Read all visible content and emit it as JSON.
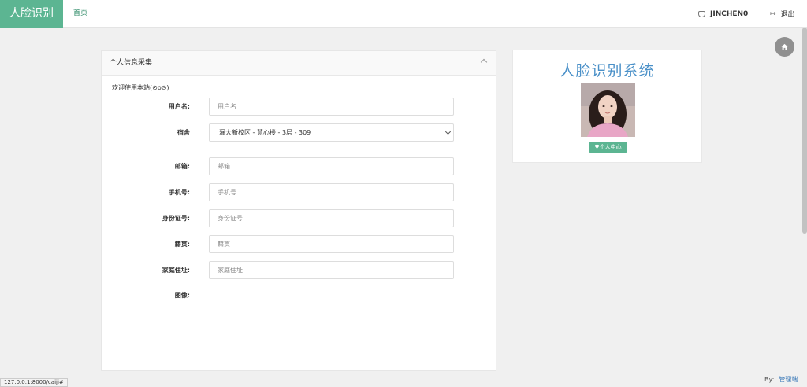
{
  "header": {
    "brand": "人脸识别",
    "nav_home": "首页",
    "username": "JINCHEN0",
    "logout": "退出"
  },
  "panel": {
    "title": "个人信息采集",
    "welcome": "欢迎使用本站(⊙o⊙)",
    "fields": {
      "username": {
        "label": "用户名:",
        "placeholder": "用户名"
      },
      "dorm": {
        "label": "宿舍",
        "value": "漏大新校区 - 慧心楼 - 3层 - 309"
      },
      "email": {
        "label": "邮箱:",
        "placeholder": "邮箱"
      },
      "phone": {
        "label": "手机号:",
        "placeholder": "手机号"
      },
      "idcard": {
        "label": "身份证号:",
        "placeholder": "身份证号"
      },
      "hometown": {
        "label": "籍贯:",
        "placeholder": "籍贯"
      },
      "address": {
        "label": "家庭住址:",
        "placeholder": "家庭住址"
      },
      "image": {
        "label": "图像:"
      }
    }
  },
  "profile": {
    "title": "人脸识别系统",
    "center_button": "♥个人中心"
  },
  "status_url": "127.0.0.1:8000/caiji#",
  "footer": {
    "by": "By:",
    "link": "管理端"
  },
  "colors": {
    "accent": "#5cb592",
    "title_blue": "#4a90c8"
  }
}
